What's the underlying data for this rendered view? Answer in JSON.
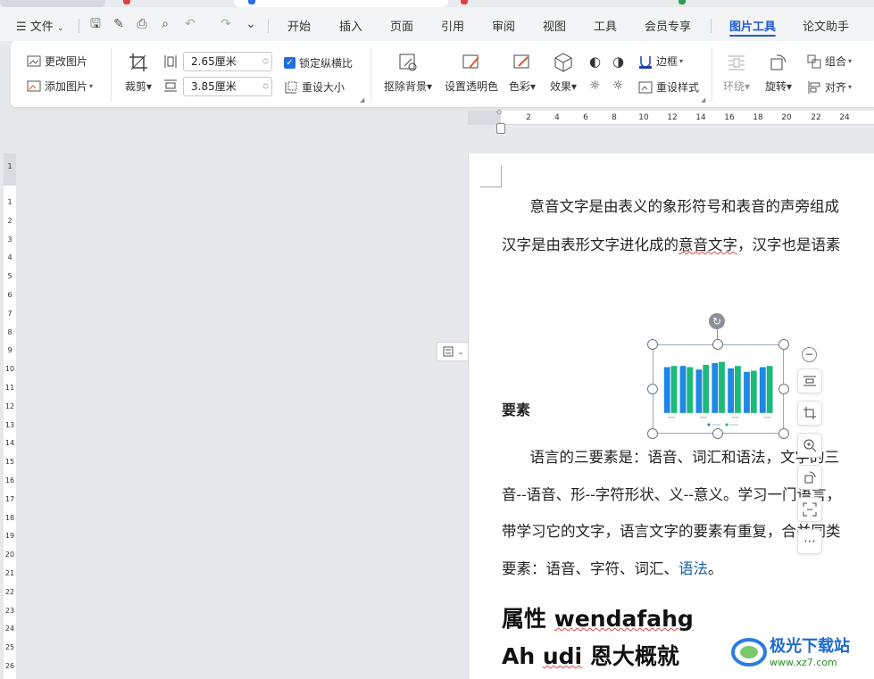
{
  "menu": {
    "file": "文件",
    "tabs": [
      "开始",
      "插入",
      "页面",
      "引用",
      "审阅",
      "视图",
      "工具",
      "会员专享",
      "图片工具",
      "论文助手"
    ],
    "active_tab": "图片工具"
  },
  "ribbon": {
    "change_picture": "更改图片",
    "add_picture": "添加图片",
    "crop": "裁剪",
    "width_value": "2.65厘米",
    "height_value": "3.85厘米",
    "lock_aspect": "锁定纵横比",
    "reset_size": "重设大小",
    "remove_bg": "抠除背景",
    "set_transparent": "设置透明色",
    "color": "色彩",
    "effects": "效果",
    "border": "边框",
    "reset_style": "重设样式",
    "wrap": "环绕",
    "rotate": "旋转",
    "group": "组合",
    "align": "对齐"
  },
  "hruler": [
    "2",
    "4",
    "6",
    "8",
    "10",
    "12",
    "14",
    "16",
    "18",
    "20",
    "22",
    "24"
  ],
  "vruler": [
    "1",
    "1",
    "2",
    "3",
    "4",
    "5",
    "6",
    "7",
    "8",
    "9",
    "10",
    "11",
    "12",
    "13",
    "14",
    "15",
    "16",
    "17",
    "18",
    "19",
    "20",
    "21",
    "22",
    "23",
    "24",
    "25",
    "26"
  ],
  "document": {
    "line1": "意音文字是由表义的象形符号和表音的声旁组成",
    "line2_a": "汉字是由表形文字进化成的",
    "line2_b": "意音文字",
    "line2_c": "，汉字也是语素",
    "heading_elements": "要素",
    "p2_line1": "语言的三要素是：语音、词汇和语法，文字的三",
    "p2_line2": "音--语音、形--字符形状、义--意义。学习一门语言，",
    "p2_line3": "带学习它的文字，语言文字的要素有重复，合并同类",
    "p2_line4_a": "要素：语音、字符、词汇、",
    "p2_line4_b": "语法",
    "p2_line4_c": "。",
    "h1_a": "属性 ",
    "h1_b": "wendafahg",
    "h2_a": "Ah ",
    "h2_b": "udi",
    "h2_c": " 恩大概就"
  },
  "chart_data": {
    "type": "bar",
    "series": [
      {
        "color": "#1e88e5",
        "values": [
          0.78,
          0.8,
          0.74,
          0.85,
          0.76,
          0.7,
          0.78
        ]
      },
      {
        "color": "#1db97a",
        "values": [
          0.8,
          0.78,
          0.82,
          0.87,
          0.8,
          0.72,
          0.8
        ]
      }
    ]
  },
  "watermark": {
    "name": "极光下载站",
    "url": "www.xz7.com"
  },
  "colors": {
    "accent": "#1f5bd6",
    "bar_blue": "#1e88e5",
    "bar_green": "#1db97a"
  }
}
